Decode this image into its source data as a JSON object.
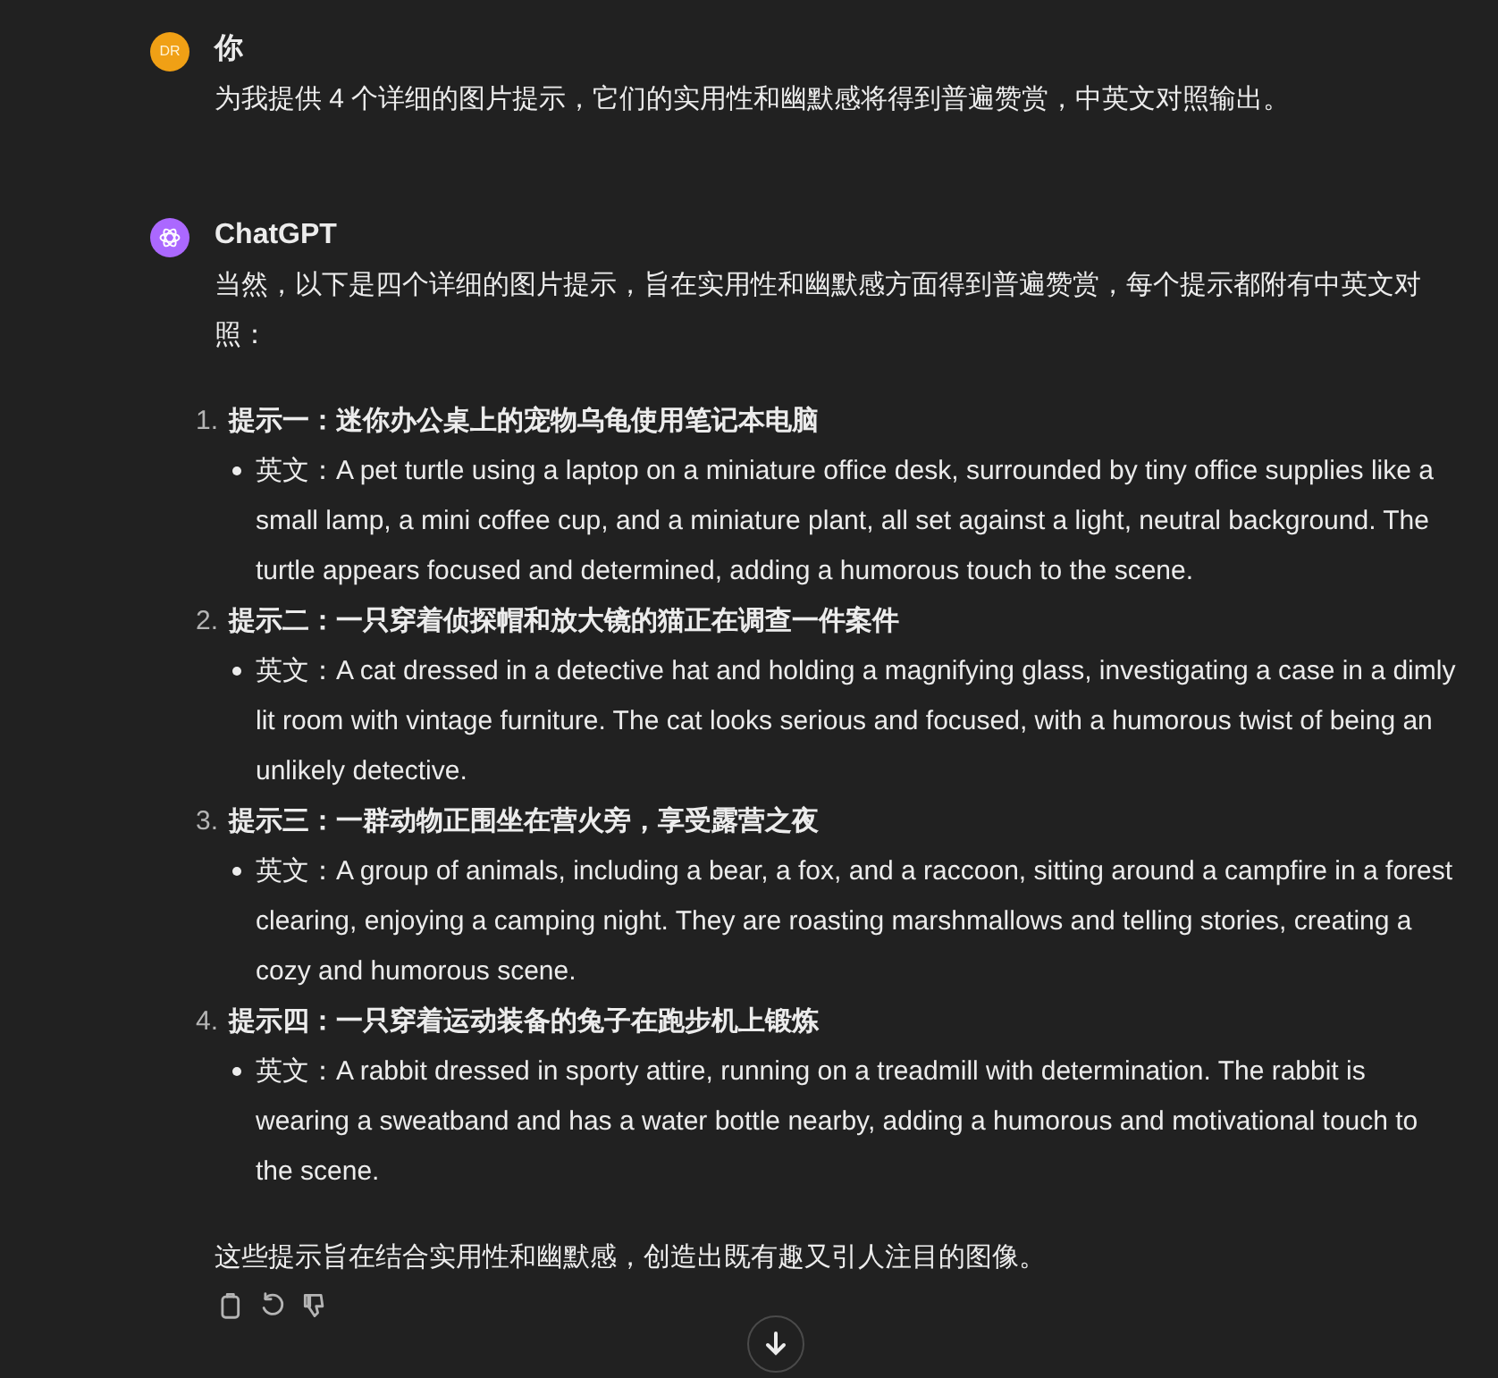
{
  "messages": [
    {
      "kind": "user",
      "avatar": "DR",
      "author": "你",
      "text": "为我提供 4 个详细的图片提示，它们的实用性和幽默感将得到普遍赞赏，中英文对照输出。"
    },
    {
      "kind": "assistant",
      "author": "ChatGPT",
      "intro": "当然，以下是四个详细的图片提示，旨在实用性和幽默感方面得到普遍赞赏，每个提示都附有中英文对照：",
      "items": [
        {
          "number": "1.",
          "title": "提示一：迷你办公桌上的宠物乌龟使用笔记本电脑",
          "detail": "英文：A pet turtle using a laptop on a miniature office desk, surrounded by tiny office supplies like a small lamp, a mini coffee cup, and a miniature plant, all set against a light, neutral background. The turtle appears focused and determined, adding a humorous touch to the scene."
        },
        {
          "number": "2.",
          "title": "提示二：一只穿着侦探帽和放大镜的猫正在调查一件案件",
          "detail": "英文：A cat dressed in a detective hat and holding a magnifying glass, investigating a case in a dimly lit room with vintage furniture. The cat looks serious and focused, with a humorous twist of being an unlikely detective."
        },
        {
          "number": "3.",
          "title": "提示三：一群动物正围坐在营火旁，享受露营之夜",
          "detail": "英文：A group of animals, including a bear, a fox, and a raccoon, sitting around a campfire in a forest clearing, enjoying a camping night. They are roasting marshmallows and telling stories, creating a cozy and humorous scene."
        },
        {
          "number": "4.",
          "title": "提示四：一只穿着运动装备的兔子在跑步机上锻炼",
          "detail": "英文：A rabbit dressed in sporty attire, running on a treadmill with determination. The rabbit is wearing a sweatband and has a water bottle nearby, adding a humorous and motivational touch to the scene."
        }
      ],
      "outro": "这些提示旨在结合实用性和幽默感，创造出既有趣又引人注目的图像。"
    }
  ]
}
